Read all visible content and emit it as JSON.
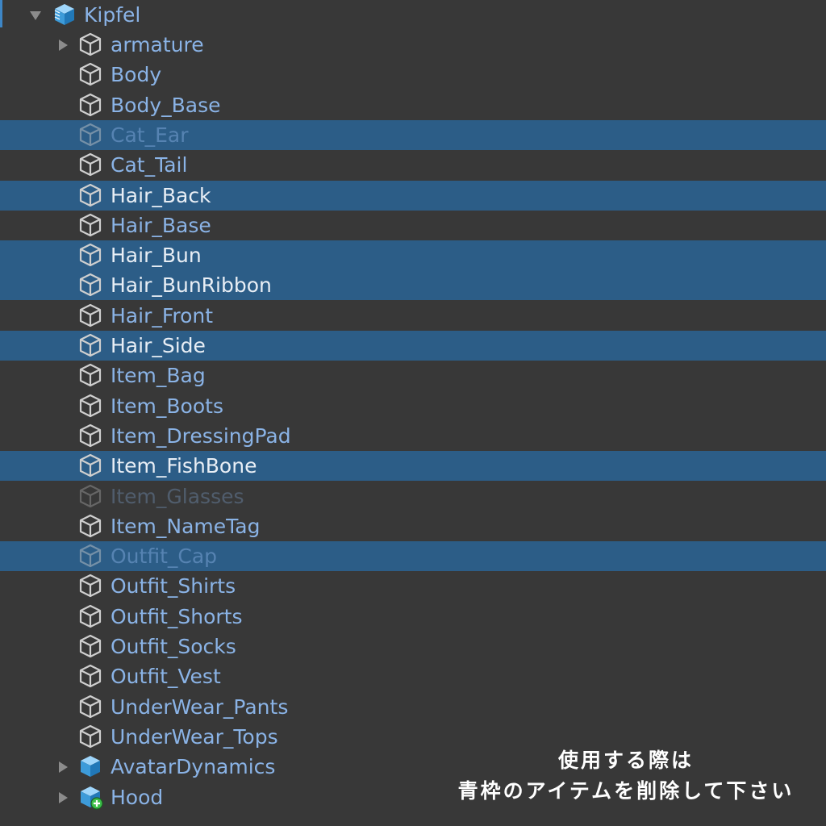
{
  "hierarchy": {
    "root": {
      "label": "Kipfel",
      "expanded": true,
      "icon": "prefab-icon"
    },
    "children": [
      {
        "label": "armature",
        "icon": "gameobject-icon",
        "collapsed": true,
        "selected": false
      },
      {
        "label": "Body",
        "icon": "gameobject-icon",
        "selected": false
      },
      {
        "label": "Body_Base",
        "icon": "gameobject-icon",
        "selected": false
      },
      {
        "label": "Cat_Ear",
        "icon": "gameobject-icon",
        "selected": true,
        "inactive": true
      },
      {
        "label": "Cat_Tail",
        "icon": "gameobject-icon",
        "selected": false
      },
      {
        "label": "Hair_Back",
        "icon": "gameobject-icon",
        "selected": true
      },
      {
        "label": "Hair_Base",
        "icon": "gameobject-icon",
        "selected": false
      },
      {
        "label": "Hair_Bun",
        "icon": "gameobject-icon",
        "selected": true
      },
      {
        "label": "Hair_BunRibbon",
        "icon": "gameobject-icon",
        "selected": true
      },
      {
        "label": "Hair_Front",
        "icon": "gameobject-icon",
        "selected": false
      },
      {
        "label": "Hair_Side",
        "icon": "gameobject-icon",
        "selected": true
      },
      {
        "label": "Item_Bag",
        "icon": "gameobject-icon",
        "selected": false
      },
      {
        "label": "Item_Boots",
        "icon": "gameobject-icon",
        "selected": false
      },
      {
        "label": "Item_DressingPad",
        "icon": "gameobject-icon",
        "selected": false
      },
      {
        "label": "Item_FishBone",
        "icon": "gameobject-icon",
        "selected": true
      },
      {
        "label": "Item_Glasses",
        "icon": "gameobject-icon",
        "selected": false,
        "inactive": true
      },
      {
        "label": "Item_NameTag",
        "icon": "gameobject-icon",
        "selected": false
      },
      {
        "label": "Outfit_Cap",
        "icon": "gameobject-icon",
        "selected": true,
        "inactive": true
      },
      {
        "label": "Outfit_Shirts",
        "icon": "gameobject-icon",
        "selected": false
      },
      {
        "label": "Outfit_Shorts",
        "icon": "gameobject-icon",
        "selected": false
      },
      {
        "label": "Outfit_Socks",
        "icon": "gameobject-icon",
        "selected": false
      },
      {
        "label": "Outfit_Vest",
        "icon": "gameobject-icon",
        "selected": false
      },
      {
        "label": "UnderWear_Pants",
        "icon": "gameobject-icon",
        "selected": false
      },
      {
        "label": "UnderWear_Tops",
        "icon": "gameobject-icon",
        "selected": false
      },
      {
        "label": "AvatarDynamics",
        "icon": "prefab-icon",
        "collapsed": true,
        "selected": false
      },
      {
        "label": "Hood",
        "icon": "prefab-added-icon",
        "collapsed": true,
        "selected": false
      }
    ]
  },
  "note": {
    "line1": "使用する際は",
    "line2": "青枠のアイテムを削除して下さい"
  },
  "colors": {
    "background": "#383838",
    "selection": "#2c5d87",
    "prefab_text": "#8ab3e6",
    "selected_text": "#e8eef5",
    "prefab_icon": "#5aaee6",
    "added_badge": "#3cc04a"
  }
}
